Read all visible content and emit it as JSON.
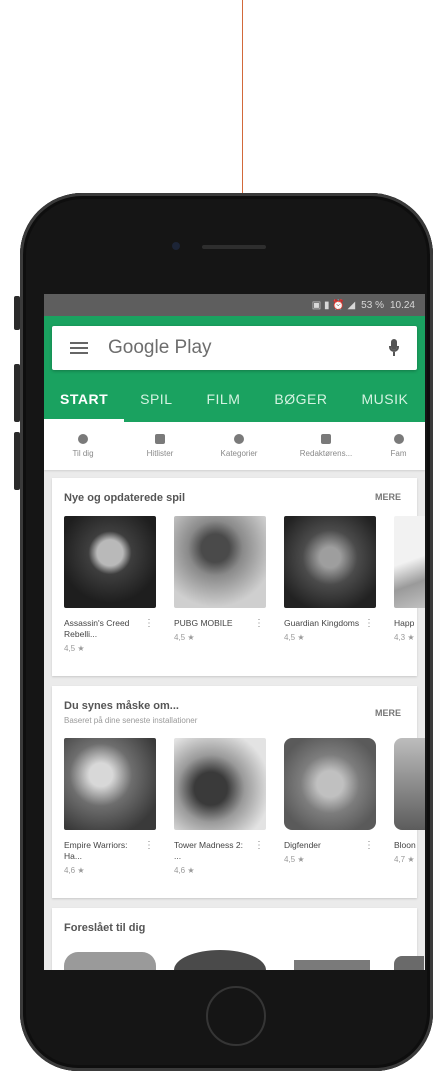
{
  "status_bar": {
    "icons_text": "▣ ▮ ⏰ ◢",
    "battery": "53 %",
    "time": "10.24"
  },
  "search": {
    "placeholder": "Google Play"
  },
  "tabs": [
    {
      "label": "START",
      "active": true
    },
    {
      "label": "SPIL"
    },
    {
      "label": "FILM"
    },
    {
      "label": "BØGER"
    },
    {
      "label": "MUSIK"
    }
  ],
  "categories": [
    {
      "label": "Til dig",
      "icon": "compass-icon"
    },
    {
      "label": "Hitlister",
      "icon": "chart-icon"
    },
    {
      "label": "Kategorier",
      "icon": "shapes-icon"
    },
    {
      "label": "Redaktørens...",
      "icon": "badge-icon"
    },
    {
      "label": "Fam",
      "icon": "star-icon"
    }
  ],
  "sections": [
    {
      "title": "Nye og opdaterede spil",
      "more": "MERE",
      "items": [
        {
          "name": "Assassin's Creed Rebelli...",
          "rating": "4,5 ★"
        },
        {
          "name": "PUBG MOBILE",
          "rating": "4,5 ★"
        },
        {
          "name": "Guardian Kingdoms",
          "rating": "4,5 ★"
        },
        {
          "name": "Happ",
          "rating": "4,3 ★"
        }
      ]
    },
    {
      "title": "Du synes måske om...",
      "subtitle": "Baseret på dine seneste installationer",
      "more": "MERE",
      "items": [
        {
          "name": "Empire Warriors: Ha...",
          "rating": "4,6 ★"
        },
        {
          "name": "Tower Madness 2: ...",
          "rating": "4,6 ★"
        },
        {
          "name": "Digfender",
          "rating": "4,5 ★"
        },
        {
          "name": "Bloon",
          "rating": "4,7 ★"
        }
      ]
    },
    {
      "title": "Foreslået til dig"
    }
  ],
  "colors": {
    "accent": "#1aa260",
    "annotation": "#d2693a"
  }
}
